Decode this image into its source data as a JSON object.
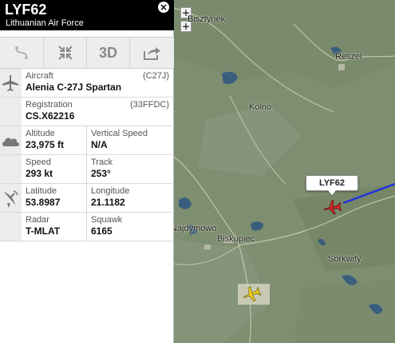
{
  "flight": {
    "callsign": "LYF62",
    "airline": "Lithuanian Air Force"
  },
  "toolbar": {
    "route_icon": "route-icon",
    "fit_icon": "compress-arrows-icon",
    "view_3d_label": "3D",
    "share_icon": "share-arrow-icon"
  },
  "details": {
    "aircraft_label": "Aircraft",
    "aircraft_value": "Alenia C-27J Spartan",
    "aircraft_code": "(C27J)",
    "registration_label": "Registration",
    "registration_value": "CS.X62216",
    "registration_code": "(33FFDC)",
    "altitude_label": "Altitude",
    "altitude_value": "23,975 ft",
    "vspeed_label": "Vertical Speed",
    "vspeed_value": "N/A",
    "speed_label": "Speed",
    "speed_value": "293 kt",
    "track_label": "Track",
    "track_value": "253°",
    "latitude_label": "Latitude",
    "latitude_value": "53.8987",
    "longitude_label": "Longitude",
    "longitude_value": "21.1182",
    "radar_label": "Radar",
    "radar_value": "T-MLAT",
    "squawk_label": "Squawk",
    "squawk_value": "6165"
  },
  "map": {
    "zoom_in": "+",
    "zoom_out": "+",
    "places": {
      "bisztynek": "Bisztynek",
      "reszel": "Reszel",
      "kolno": "Kolno",
      "najdymowo": "Najdymowo",
      "biskupiec": "Biskupiec",
      "sorkwity": "Sorkwity"
    },
    "callout": "LYF62",
    "selected_plane_color": "#d62828",
    "other_plane_color": "#f2d21b",
    "route_color": "#2233dd"
  }
}
